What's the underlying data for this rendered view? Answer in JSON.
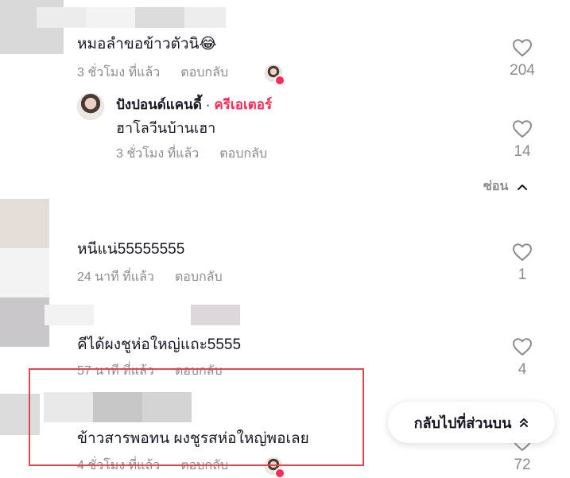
{
  "comments": [
    {
      "text": "หมอลำขอข้าวตัวนิ😂",
      "time": "3 ชั่วโมง ที่แล้ว",
      "reply_label": "ตอบกลับ",
      "likes": "204"
    },
    {
      "text": "หนีแน่55555555",
      "time": "24 นาที ที่แล้ว",
      "reply_label": "ตอบกลับ",
      "likes": "1"
    },
    {
      "text": "คีได้ผงชูห่อใหญ่แถะ5555",
      "time": "57 นาที ที่แล้ว",
      "reply_label": "ตอบกลับ",
      "likes": "4"
    },
    {
      "text": "ข้าวสารพอทน ผงชูรสห่อใหญ่พอเลย",
      "time": "4 ชั่วโมง ที่แล้ว",
      "reply_label": "ตอบกลับ",
      "likes": "72"
    }
  ],
  "creator_reply": {
    "name": "ปังปอนด์แคนดี้",
    "separator": "·",
    "badge": "ครีเอเตอร์",
    "text": "ฮาโลวีนบ้านเฮา",
    "time": "3 ชั่วโมง ที่แล้ว",
    "reply_label": "ตอบกลับ",
    "likes": "14"
  },
  "hide_replies_label": "ซ่อน",
  "back_to_top_label": "กลับไปที่ส่วนบน",
  "icons": {
    "like": "heart-outline-icon",
    "hide": "chevron-up-icon",
    "back_to_top": "double-chevron-up-icon"
  },
  "colors": {
    "text": "#161823",
    "muted": "#8a8b91",
    "creator_badge": "#fe2c55",
    "highlight": "#e0484d"
  }
}
